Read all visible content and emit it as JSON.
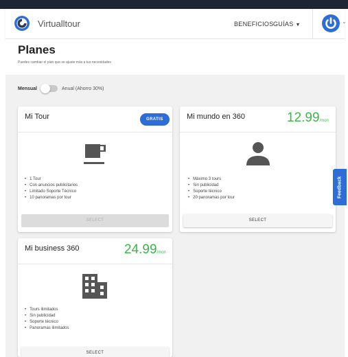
{
  "navbar": {
    "brand": "Virtualltour",
    "links": [
      {
        "label": "BENEFICIOS"
      },
      {
        "label": "GUÍAS"
      }
    ],
    "accent": "#2f6dd6"
  },
  "page": {
    "title": "Planes",
    "subtitle": "Puedes cambiar el plan que se ajuste más a tus necesidades"
  },
  "billing_toggle": {
    "label_left": "Mensual",
    "label_right": "Anual (Ahorro 30%)",
    "state": "off"
  },
  "plans": [
    {
      "title": "Mi Tour",
      "badge": "GRATIS",
      "icon": "coffee-cup-icon",
      "features": [
        "1 Tour",
        "Con anuncios publicitarios",
        "Limitado Soporte Técnico",
        "10 panoramas por tour"
      ],
      "button": "SELECT",
      "button_state": "disabled"
    },
    {
      "title": "Mi mundo en 360",
      "price": "12.99",
      "unit": "/mon",
      "icon": "person-icon",
      "features": [
        "Máximo 3 tours",
        "Sin publicidad",
        "Soporte técnico",
        "20 panoramas por tour"
      ],
      "button": "SELECT",
      "button_state": "enabled"
    },
    {
      "title": "Mi business 360",
      "price": "24.99",
      "unit": "/mon",
      "icon": "building-icon",
      "features": [
        "Tours ilimitados",
        "Sin publicidad",
        "Soporte técnico",
        "Panoramas ilimitados"
      ],
      "button": "SELECT",
      "button_state": "enabled"
    }
  ],
  "feedback_tab": "Feedback",
  "colors": {
    "price_green": "#3db54a",
    "badge_blue": "#2f6dd6",
    "icon_gray": "#555555"
  }
}
